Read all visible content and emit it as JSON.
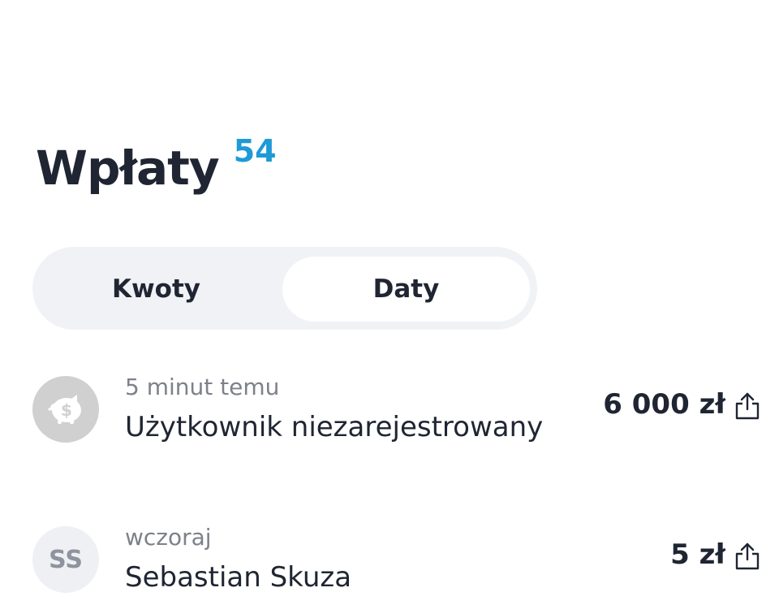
{
  "header": {
    "title": "Wpłaty",
    "count": "54"
  },
  "segmented_control": {
    "options": [
      {
        "label": "Kwoty",
        "selected": false
      },
      {
        "label": "Daty",
        "selected": true
      }
    ]
  },
  "payments": [
    {
      "time": "5 minut temu",
      "name": "Użytkownik niezarejestrowany",
      "amount": "6 000 zł",
      "avatar": "piggy-bank-icon"
    },
    {
      "time": "wczoraj",
      "name": "Sebastian Skuza",
      "amount": "5 zł",
      "avatar_initials": "SS"
    }
  ],
  "colors": {
    "accent": "#1e9ad6",
    "text": "#1f2532",
    "muted": "#7d8189",
    "segment_bg": "#f1f2f6"
  }
}
